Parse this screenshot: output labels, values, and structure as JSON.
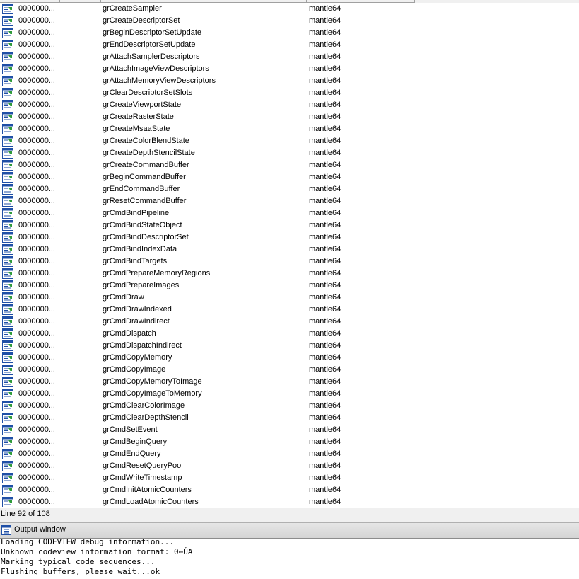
{
  "rows": [
    {
      "address": "0000000...",
      "name": "grCreateSampler",
      "library": "mantle64"
    },
    {
      "address": "0000000...",
      "name": "grCreateDescriptorSet",
      "library": "mantle64"
    },
    {
      "address": "0000000...",
      "name": "grBeginDescriptorSetUpdate",
      "library": "mantle64"
    },
    {
      "address": "0000000...",
      "name": "grEndDescriptorSetUpdate",
      "library": "mantle64"
    },
    {
      "address": "0000000...",
      "name": "grAttachSamplerDescriptors",
      "library": "mantle64"
    },
    {
      "address": "0000000...",
      "name": "grAttachImageViewDescriptors",
      "library": "mantle64"
    },
    {
      "address": "0000000...",
      "name": "grAttachMemoryViewDescriptors",
      "library": "mantle64"
    },
    {
      "address": "0000000...",
      "name": "grClearDescriptorSetSlots",
      "library": "mantle64"
    },
    {
      "address": "0000000...",
      "name": "grCreateViewportState",
      "library": "mantle64"
    },
    {
      "address": "0000000...",
      "name": "grCreateRasterState",
      "library": "mantle64"
    },
    {
      "address": "0000000...",
      "name": "grCreateMsaaState",
      "library": "mantle64"
    },
    {
      "address": "0000000...",
      "name": "grCreateColorBlendState",
      "library": "mantle64"
    },
    {
      "address": "0000000...",
      "name": "grCreateDepthStencilState",
      "library": "mantle64"
    },
    {
      "address": "0000000...",
      "name": "grCreateCommandBuffer",
      "library": "mantle64"
    },
    {
      "address": "0000000...",
      "name": "grBeginCommandBuffer",
      "library": "mantle64"
    },
    {
      "address": "0000000...",
      "name": "grEndCommandBuffer",
      "library": "mantle64"
    },
    {
      "address": "0000000...",
      "name": "grResetCommandBuffer",
      "library": "mantle64"
    },
    {
      "address": "0000000...",
      "name": "grCmdBindPipeline",
      "library": "mantle64"
    },
    {
      "address": "0000000...",
      "name": "grCmdBindStateObject",
      "library": "mantle64"
    },
    {
      "address": "0000000...",
      "name": "grCmdBindDescriptorSet",
      "library": "mantle64"
    },
    {
      "address": "0000000...",
      "name": "grCmdBindIndexData",
      "library": "mantle64"
    },
    {
      "address": "0000000...",
      "name": "grCmdBindTargets",
      "library": "mantle64"
    },
    {
      "address": "0000000...",
      "name": "grCmdPrepareMemoryRegions",
      "library": "mantle64"
    },
    {
      "address": "0000000...",
      "name": "grCmdPrepareImages",
      "library": "mantle64"
    },
    {
      "address": "0000000...",
      "name": "grCmdDraw",
      "library": "mantle64"
    },
    {
      "address": "0000000...",
      "name": "grCmdDrawIndexed",
      "library": "mantle64"
    },
    {
      "address": "0000000...",
      "name": "grCmdDrawIndirect",
      "library": "mantle64"
    },
    {
      "address": "0000000...",
      "name": "grCmdDispatch",
      "library": "mantle64"
    },
    {
      "address": "0000000...",
      "name": "grCmdDispatchIndirect",
      "library": "mantle64"
    },
    {
      "address": "0000000...",
      "name": "grCmdCopyMemory",
      "library": "mantle64"
    },
    {
      "address": "0000000...",
      "name": "grCmdCopyImage",
      "library": "mantle64"
    },
    {
      "address": "0000000...",
      "name": "grCmdCopyMemoryToImage",
      "library": "mantle64"
    },
    {
      "address": "0000000...",
      "name": "grCmdCopyImageToMemory",
      "library": "mantle64"
    },
    {
      "address": "0000000...",
      "name": "grCmdClearColorImage",
      "library": "mantle64"
    },
    {
      "address": "0000000...",
      "name": "grCmdClearDepthStencil",
      "library": "mantle64"
    },
    {
      "address": "0000000...",
      "name": "grCmdSetEvent",
      "library": "mantle64"
    },
    {
      "address": "0000000...",
      "name": "grCmdBeginQuery",
      "library": "mantle64"
    },
    {
      "address": "0000000...",
      "name": "grCmdEndQuery",
      "library": "mantle64"
    },
    {
      "address": "0000000...",
      "name": "grCmdResetQueryPool",
      "library": "mantle64"
    },
    {
      "address": "0000000...",
      "name": "grCmdWriteTimestamp",
      "library": "mantle64"
    },
    {
      "address": "0000000...",
      "name": "grCmdInitAtomicCounters",
      "library": "mantle64"
    },
    {
      "address": "0000000...",
      "name": "grCmdLoadAtomicCounters",
      "library": "mantle64"
    }
  ],
  "row_icon": "import-function-icon",
  "status": {
    "line_info": "Line 92 of 108"
  },
  "output_window": {
    "title": "Output window",
    "icon": "output-window-icon",
    "lines": [
      "Loading CODEVIEW debug information...",
      "Unknown codeview information format: 0←ÚA",
      "Marking typical code sequences...",
      "Flushing buffers, please wait...ok"
    ]
  },
  "colors": {
    "icon_blue": "#1f4fa6",
    "icon_green": "#2e9a3a",
    "panel": "#f0f0f0"
  }
}
